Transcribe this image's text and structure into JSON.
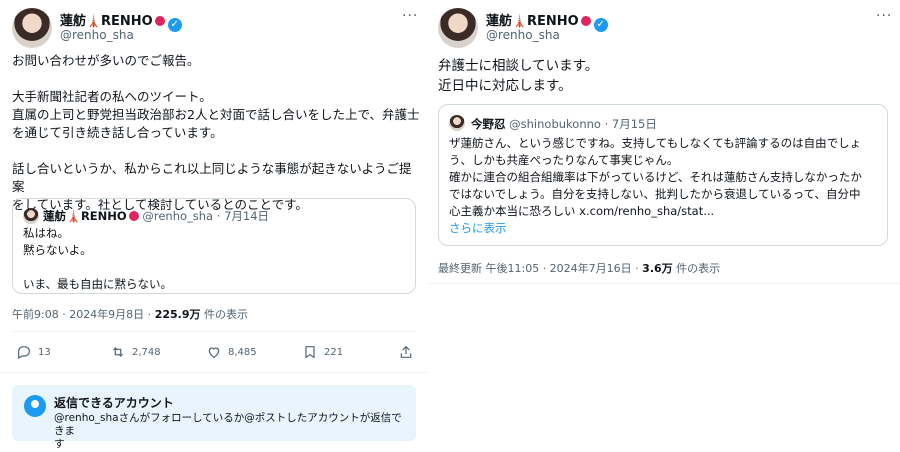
{
  "left_tweet": {
    "author_name": "蓮舫",
    "author_name_suffix": "RENHO",
    "handle": "@renho_sha",
    "body": "お問い合わせが多いのでご報告。\n\n大手新聞社記者の私へのツイート。\n直属の上司と野党担当政治部お2人と対面で話し合いをした上で、弁護士\nを通じて引き続き話し合っています。\n\n話し合いというか、私からこれ以上同じような事態が起きないようご提案\nをしています。社として検討しているとのことです。",
    "quote": {
      "author_name": "蓮舫",
      "author_name_suffix": "RENHO",
      "handle": "@renho_sha",
      "date": "7月14日",
      "body": "私はね。\n黙らないよ。\n\nいま、最も自由に黙らない。"
    },
    "timestamp": "午前9:08 · 2024年9月8日 · ",
    "views_count": "225.9万",
    "views_label": " 件の表示",
    "actions": {
      "replies": "13",
      "reposts": "2,748",
      "likes": "8,485",
      "bookmarks": "221"
    },
    "reply_restriction": {
      "title": "返信できるアカウント",
      "text": "@renho_shaさんがフォローしているか@ポストしたアカウントが返信できま\nす"
    }
  },
  "right_tweet": {
    "author_name": "蓮舫",
    "author_name_suffix": "RENHO",
    "handle": "@renho_sha",
    "body": "弁護士に相談しています。\n近日中に対応します。",
    "quote": {
      "author_name": "今野忍",
      "handle": "@shinobukonno",
      "date": "7月15日",
      "body": "ザ蓮舫さん、という感じですね。支持してもしなくても評論するのは自由でしょ\nう、しかも共産ぺったりなんて事実じゃん。\n確かに連合の組合組織率は下がっているけど、それは蓮舫さん支持しなかったか\nではないでしょう。自分を支持しない、批判したから衰退しているって、自分中\n心主義か本当に恐ろしい x.com/renho_sha/stat...",
      "show_more": "さらに表示"
    },
    "timestamp": "最終更新 午後11:05 · 2024年7月16日 · ",
    "views_count": "3.6万",
    "views_label": " 件の表示"
  },
  "icons": {
    "more": "more-dots-icon",
    "verified": "verified-badge-icon",
    "reply": "reply-icon",
    "repost": "repost-icon",
    "like": "heart-icon",
    "bookmark": "bookmark-icon",
    "share": "share-icon"
  },
  "colors": {
    "accent": "#1d9bf0",
    "text": "#0f1419",
    "muted": "#536471",
    "reply_box": "#e8f5fd"
  }
}
